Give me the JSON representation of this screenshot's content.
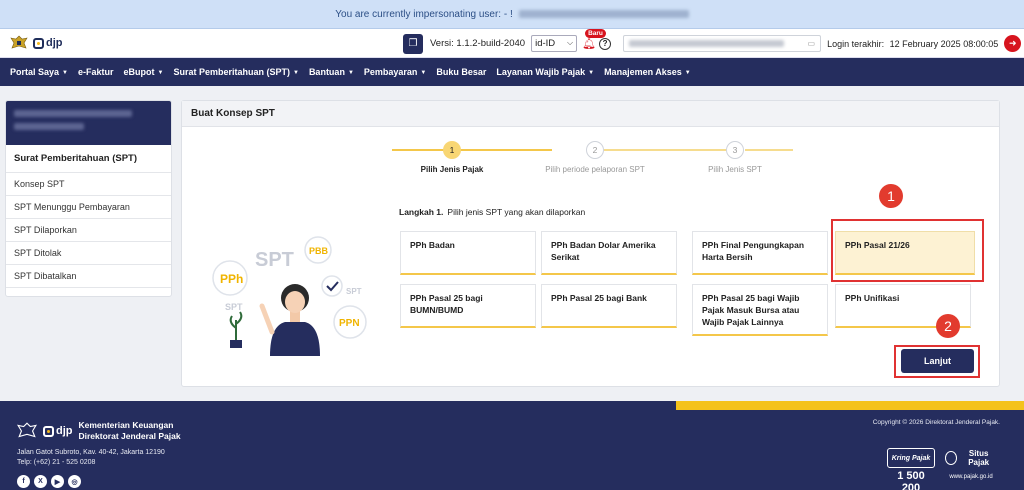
{
  "banner": {
    "text": "You are currently impersonating user: - !"
  },
  "topbar": {
    "version_label": "Versi:",
    "version": "1.1.2-build-2040",
    "lang": "id-ID",
    "bell_badge": "Baru",
    "help": "?",
    "login_label": "Login terakhir:",
    "login_time": "12 February 2025 08:00:05"
  },
  "brand": {
    "name": "djp"
  },
  "nav": [
    "Portal Saya",
    "e-Faktur",
    "eBupot",
    "Surat Pemberitahuan (SPT)",
    "Bantuan",
    "Pembayaran",
    "Buku Besar",
    "Layanan Wajib Pajak",
    "Manajemen Akses"
  ],
  "nav_dropdown": [
    true,
    false,
    true,
    true,
    true,
    true,
    false,
    true,
    true
  ],
  "sidebar": {
    "title": "Surat Pemberitahuan (SPT)",
    "items": [
      "Konsep SPT",
      "SPT Menunggu Pembayaran",
      "SPT Dilaporkan",
      "SPT Ditolak",
      "SPT Dibatalkan"
    ]
  },
  "panel": {
    "title": "Buat Konsep SPT"
  },
  "steps": [
    {
      "num": "1",
      "label": "Pilih Jenis Pajak",
      "active": true
    },
    {
      "num": "2",
      "label": "Pilih periode pelaporan SPT",
      "active": false
    },
    {
      "num": "3",
      "label": "Pilih Jenis SPT",
      "active": false
    }
  ],
  "instruction": {
    "step": "Langkah 1.",
    "text": "Pilih jenis SPT yang akan dilaporkan"
  },
  "illustration": {
    "tags": [
      "SPT",
      "PBB",
      "PPh",
      "SPT",
      "SPT",
      "PPN"
    ]
  },
  "cards": [
    {
      "label": "PPh Badan",
      "selected": false
    },
    {
      "label": "PPh Badan Dolar Amerika Serikat",
      "selected": false
    },
    {
      "label": "PPh Final Pengungkapan Harta Bersih",
      "selected": false
    },
    {
      "label": "PPh Pasal 21/26",
      "selected": true
    },
    {
      "label": "PPh Pasal 25 bagi BUMN/BUMD",
      "selected": false
    },
    {
      "label": "PPh Pasal 25 bagi Bank",
      "selected": false
    },
    {
      "label": "PPh Pasal 25 bagi Wajib Pajak Masuk Bursa atau Wajib Pajak Lainnya",
      "selected": false
    },
    {
      "label": "PPh Unifikasi",
      "selected": false
    }
  ],
  "callouts": [
    "1",
    "2"
  ],
  "next_button": "Lanjut",
  "footer": {
    "org_line1": "Kementerian Keuangan",
    "org_line2": "Direktorat Jenderal Pajak",
    "address": "Jalan Gatot Subroto, Kav. 40-42, Jakarta 12190",
    "phone": "Telp: (+62) 21 - 525 0208",
    "copyright": "Copyright © 2026 Direktorat Jenderal Pajak.",
    "kring_label": "Kring Pajak",
    "kring_number": "1 500 200",
    "situs_label": "Situs Pajak",
    "situs_url": "www.pajak.go.id",
    "socials": [
      "f",
      "X",
      "▶",
      "◎"
    ]
  },
  "colors": {
    "navy": "#252d5e",
    "accent_yellow": "#f4c21b",
    "highlight_red": "#e03232",
    "danger": "#d7141e"
  }
}
